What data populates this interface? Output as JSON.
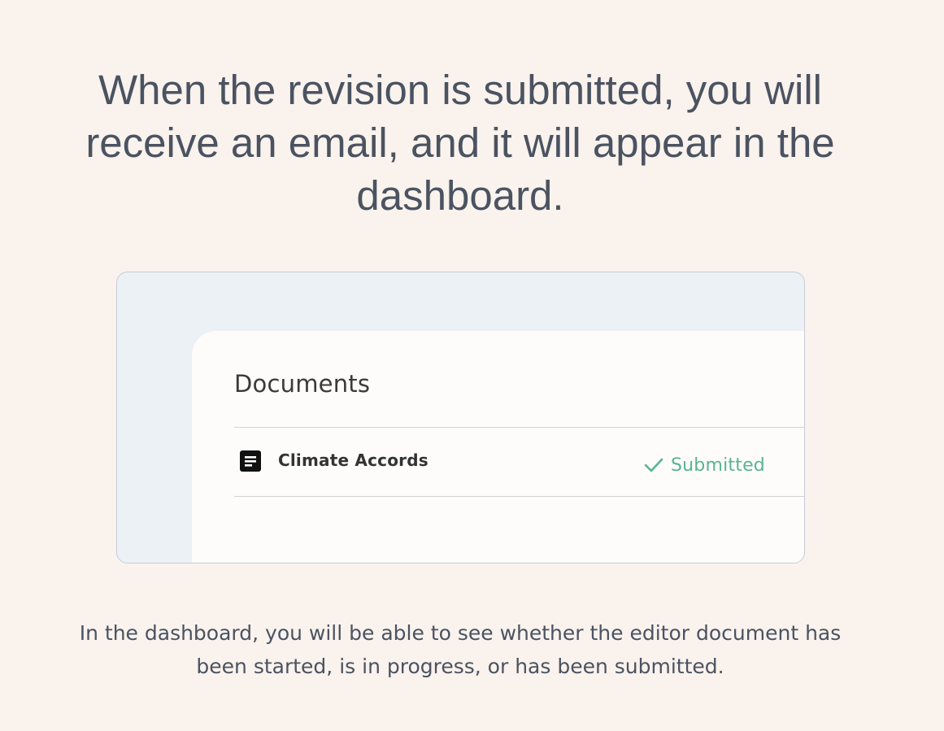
{
  "headline": "When the revision is submitted, you will receive an email, and it will appear in the dashboard.",
  "preview": {
    "title": "Documents",
    "documents": [
      {
        "name": "Climate Accords",
        "icon": "document-icon",
        "status": "Submitted",
        "status_icon": "check-icon",
        "status_color": "#58b58e"
      }
    ]
  },
  "caption": "In the dashboard, you will be able to see whether the editor document has been started, is in progress, or has been submitted."
}
